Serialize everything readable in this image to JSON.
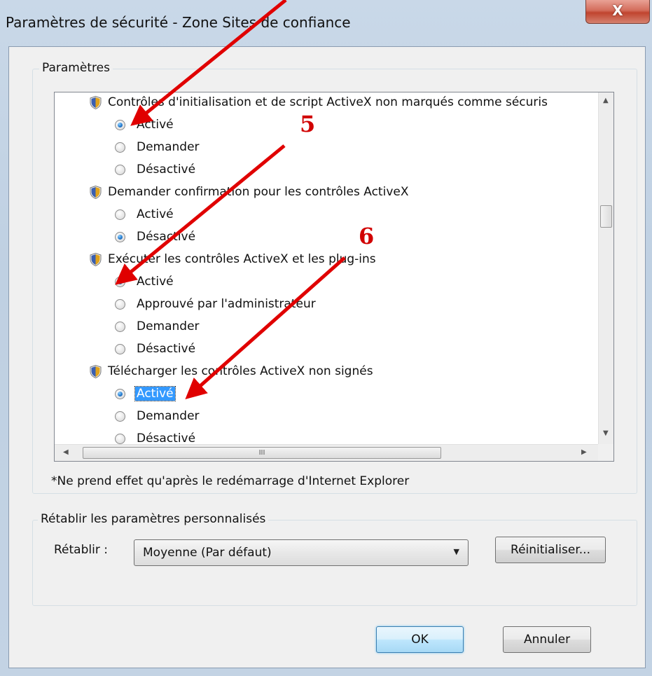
{
  "window": {
    "title": "Paramètres de sécurité - Zone Sites de confiance",
    "close_label": "X"
  },
  "settings": {
    "group_label": "Paramètres",
    "items": [
      {
        "header": "Contrôles d'initialisation et de script ActiveX non marqués comme sécuris",
        "options": [
          {
            "label": "Activé",
            "selected": true
          },
          {
            "label": "Demander",
            "selected": false
          },
          {
            "label": "Désactivé",
            "selected": false
          }
        ]
      },
      {
        "header": "Demander confirmation pour les contrôles ActiveX",
        "options": [
          {
            "label": "Activé",
            "selected": false
          },
          {
            "label": "Désactivé",
            "selected": true
          }
        ]
      },
      {
        "header": "Exécuter les contrôles ActiveX et les plug-ins",
        "options": [
          {
            "label": "Activé",
            "selected": true
          },
          {
            "label": "Approuvé par l'administrateur",
            "selected": false
          },
          {
            "label": "Demander",
            "selected": false
          },
          {
            "label": "Désactivé",
            "selected": false
          }
        ]
      },
      {
        "header": "Télécharger les contrôles ActiveX non signés",
        "options": [
          {
            "label": "Activé",
            "selected": true,
            "highlighted": true
          },
          {
            "label": "Demander",
            "selected": false
          },
          {
            "label": "Désactivé",
            "selected": false
          }
        ]
      }
    ],
    "note": "*Ne prend effet qu'après le redémarrage d'Internet Explorer",
    "scroll_glyph": "III"
  },
  "reset": {
    "group_label": "Rétablir les paramètres personnalisés",
    "label": "Rétablir :",
    "selected_value": "Moyenne (Par défaut)",
    "button_label": "Réinitialiser..."
  },
  "footer": {
    "ok_label": "OK",
    "cancel_label": "Annuler"
  },
  "annotations": {
    "marker_5": "5",
    "marker_6": "6",
    "arrow_color": "#e00000"
  }
}
